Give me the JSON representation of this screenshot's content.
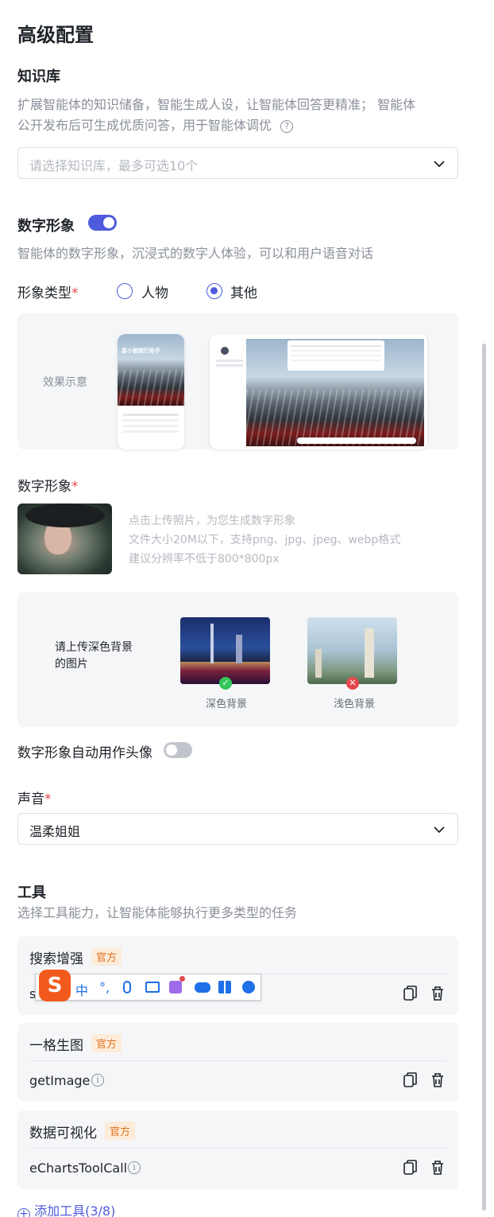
{
  "page_title": "高级配置",
  "knowledge": {
    "title": "知识库",
    "desc_line1": "扩展智能体的知识储备，智能生成人设，让智能体回答更精准； 智能体",
    "desc_line2": "公开发布后可生成优质问答，用于智能体调优",
    "help_icon": "question-circle-icon",
    "placeholder": "请选择知识库，最多可选10个"
  },
  "digital": {
    "title": "数字形象",
    "toggle_on": true,
    "desc": "智能体的数字形象，沉浸式的数字人体验，可以和用户语音对话",
    "type_label": "形象类型",
    "required_mark": "*",
    "options": [
      "人物",
      "其他"
    ],
    "selected": "其他",
    "preview_label": "效果示意",
    "preview_phone_title": "星小驰旅行助手",
    "avatar_label": "数字形象",
    "upload_hint1": "点击上传照片，为您生成数字形象",
    "upload_hint2": "文件大小20M以下，支持png、jpg、jpeg、webp格式",
    "upload_hint3": "建议分辨率不低于800*800px",
    "bg_hint_line1": "请上传深色背景",
    "bg_hint_line2": "的图片",
    "dark_bg_label": "深色背景",
    "light_bg_label": "浅色背景",
    "auto_avatar_label": "数字形象自动用作头像",
    "auto_avatar_on": false
  },
  "voice": {
    "label": "声音",
    "value": "温柔姐姐"
  },
  "tools": {
    "title": "工具",
    "desc": "选择工具能力，让智能体能够执行更多类型的任务",
    "badge": "官方",
    "items": [
      {
        "name": "搜索增强",
        "func": "se"
      },
      {
        "name": "一格生图",
        "func": "getImage"
      },
      {
        "name": "数据可视化",
        "func": "eChartsToolCall"
      }
    ],
    "add_label": "添加工具(3/8)"
  },
  "ime_toolbar": {
    "logo": "S",
    "mode": "中",
    "punct": "°,",
    "icons": [
      "microphone-icon",
      "keyboard-icon",
      "skin-icon",
      "gamepad-icon",
      "apps-icon",
      "settings-icon"
    ]
  },
  "colors": {
    "accent": "#4e5bdc",
    "required": "#e5484d",
    "badge_text": "#e07020",
    "badge_bg": "#fdecd9",
    "panel_bg": "#f5f6f8",
    "success": "#34c759",
    "error": "#e5484d"
  }
}
